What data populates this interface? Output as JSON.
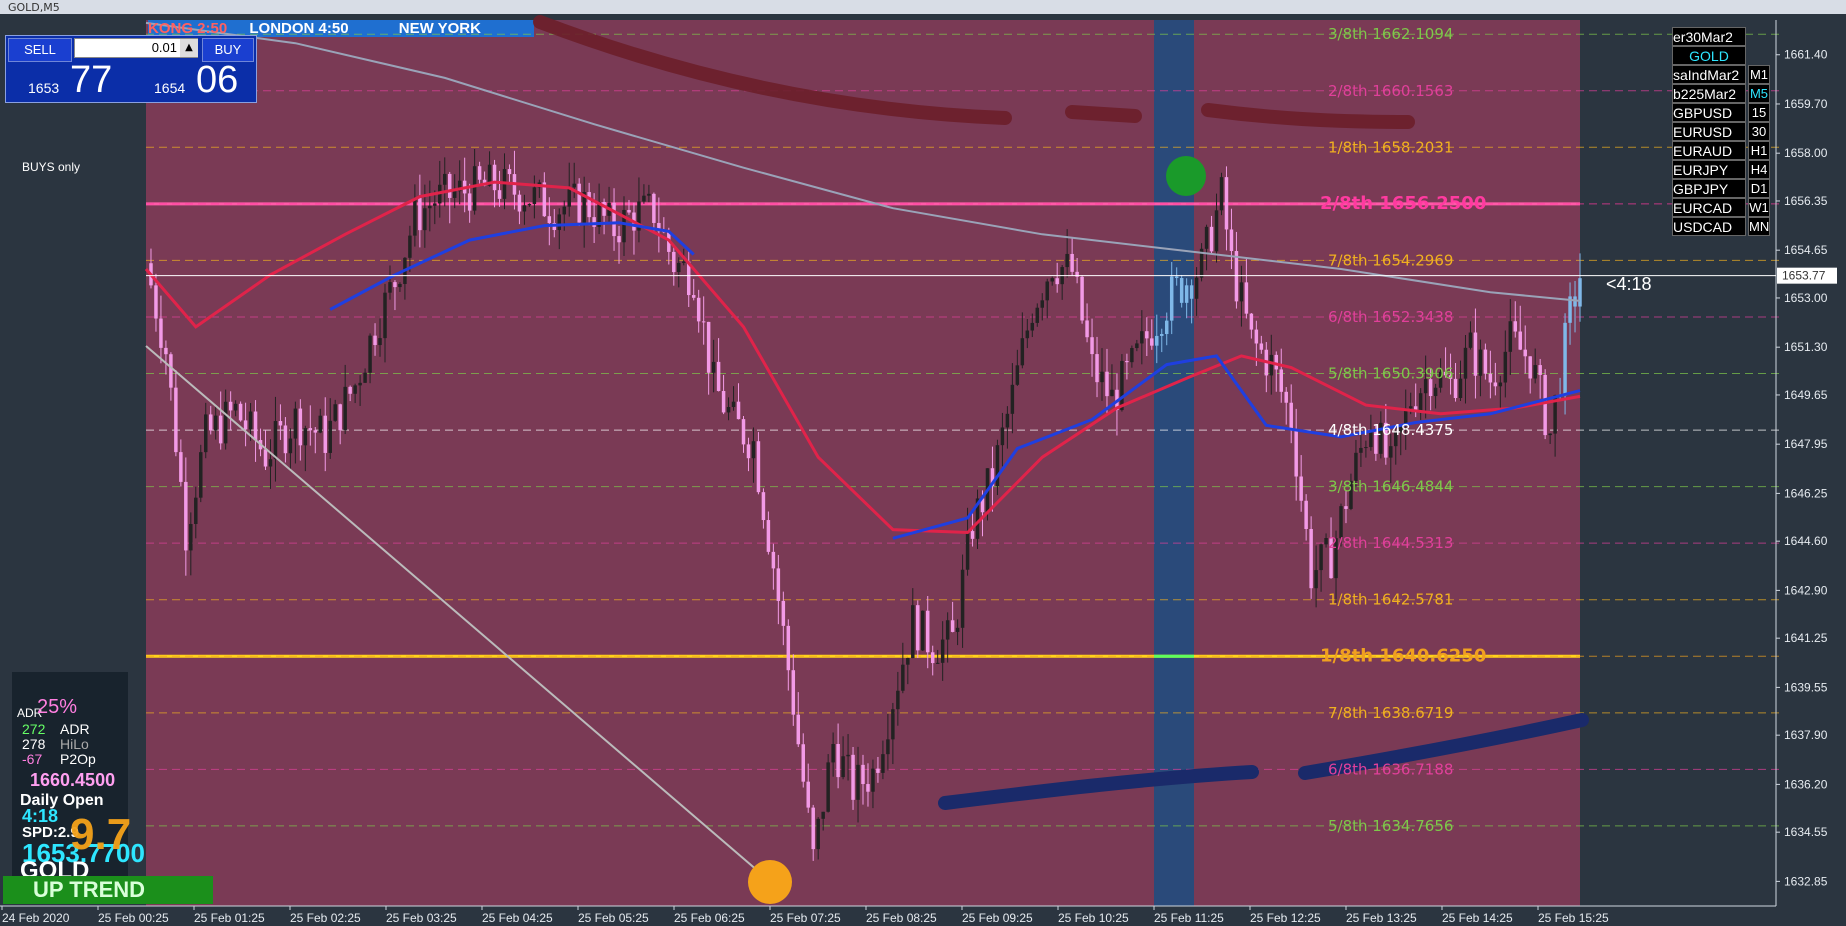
{
  "window": {
    "title": "GOLD,M5"
  },
  "colors": {
    "background": "#2b3540",
    "chart_bg": "#7a3a55",
    "highlight_band": "#2a4a7a",
    "bull_candle": "#222222",
    "bear_candle": "#f29ae6",
    "ma_red": "#e0234a",
    "ma_gray": "#9aa3b8",
    "ma_blue": "#1f3fe0",
    "pink_level": "#ff5aa8",
    "yellow_level": "#ffd21a"
  },
  "sessions": {
    "tokyo": "KONG 2:50",
    "london": "LONDON 4:50",
    "newyork": "NEW YORK"
  },
  "trade_panel": {
    "sell_label": "SELL",
    "buy_label": "BUY",
    "lot": "0.01",
    "sell_prefix": "1653",
    "sell_big": "77",
    "buy_prefix": "1654",
    "buy_big": "06",
    "down_icon": "triangle-down-icon",
    "up_icon": "triangle-up-icon"
  },
  "buys_only": "BUYS only",
  "info_panel": {
    "pct": "25%",
    "adr_val": "272",
    "adr_label": "ADR",
    "adr_tag": "ADR",
    "hilo_val": "278",
    "hilo_label": "HiLo",
    "p2o_val": "-67",
    "p2o_label": "P2Op",
    "daily_open_price": "1660.4500",
    "daily_open_label": "Daily Open",
    "timer": "4:18",
    "spd": "SPD:2.9",
    "price": "1653.7700",
    "big_overlay": "9.7",
    "symbol": "GOLD"
  },
  "trend": "UP TREND",
  "symbols": [
    {
      "name": "er30Mar2",
      "tf": ""
    },
    {
      "name": "GOLD",
      "tf": "",
      "active": true
    },
    {
      "name": "saIndMar2",
      "tf": "M1"
    },
    {
      "name": "b225Mar2",
      "tf": "M5",
      "tf_active": true
    },
    {
      "name": "GBPUSD",
      "tf": "15"
    },
    {
      "name": "EURUSD",
      "tf": "30"
    },
    {
      "name": "EURAUD",
      "tf": "H1"
    },
    {
      "name": "EURJPY",
      "tf": "H4"
    },
    {
      "name": "GBPJPY",
      "tf": "D1"
    },
    {
      "name": "EURCAD",
      "tf": "W1"
    },
    {
      "name": "USDCAD",
      "tf": "MN"
    }
  ],
  "countdown": "<4:18",
  "chart_data": {
    "type": "candlestick",
    "ylim": [
      1632.0,
      1662.6
    ],
    "yticks": [
      "1661.40",
      "1659.70",
      "1658.00",
      "1656.35",
      "1654.65",
      "1653.00",
      "1651.30",
      "1649.65",
      "1647.95",
      "1646.25",
      "1644.60",
      "1642.90",
      "1641.25",
      "1639.55",
      "1637.90",
      "1636.20",
      "1634.55",
      "1632.85"
    ],
    "current_price": "1653.77",
    "xticks": [
      "24 Feb 2020",
      "25 Feb 00:25",
      "25 Feb 01:25",
      "25 Feb 02:25",
      "25 Feb 03:25",
      "25 Feb 04:25",
      "25 Feb 05:25",
      "25 Feb 06:25",
      "25 Feb 07:25",
      "25 Feb 08:25",
      "25 Feb 09:25",
      "25 Feb 10:25",
      "25 Feb 11:25",
      "25 Feb 12:25",
      "25 Feb 13:25",
      "25 Feb 14:25",
      "25 Feb 15:25"
    ],
    "murrey_levels": [
      {
        "label": "3/8th  1662.1094",
        "price": 1662.1094,
        "color": "#7ec84a",
        "style": "small"
      },
      {
        "label": "2/8th  1660.1563",
        "price": 1660.1563,
        "color": "#e0409a",
        "style": "small"
      },
      {
        "label": "1/8th  1658.2031",
        "price": 1658.2031,
        "color": "#f0b020",
        "style": "small"
      },
      {
        "label": "2/8th  1656.2500",
        "price": 1656.25,
        "color": "#ff3aa0",
        "style": "big",
        "line": "#ff5aa8"
      },
      {
        "label": "7/8th  1654.2969",
        "price": 1654.2969,
        "color": "#f0b020",
        "style": "small"
      },
      {
        "label": "6/8th  1652.3438",
        "price": 1652.3438,
        "color": "#e0409a",
        "style": "small"
      },
      {
        "label": "5/8th  1650.3906",
        "price": 1650.3906,
        "color": "#7ec84a",
        "style": "small"
      },
      {
        "label": "4/8th  1648.4375",
        "price": 1648.4375,
        "color": "#ffffff",
        "style": "small"
      },
      {
        "label": "3/8th  1646.4844",
        "price": 1646.4844,
        "color": "#7ec84a",
        "style": "small"
      },
      {
        "label": "2/8th  1644.5313",
        "price": 1644.5313,
        "color": "#e0409a",
        "style": "small"
      },
      {
        "label": "1/8th  1642.5781",
        "price": 1642.5781,
        "color": "#f0b020",
        "style": "small"
      },
      {
        "label": "1/8th  1640.6250",
        "price": 1640.625,
        "color": "#f0a020",
        "style": "big",
        "line": "#ffd21a"
      },
      {
        "label": "7/8th  1638.6719",
        "price": 1638.6719,
        "color": "#f0b020",
        "style": "small"
      },
      {
        "label": "6/8th  1636.7188",
        "price": 1636.7188,
        "color": "#e0409a",
        "style": "small"
      },
      {
        "label": "5/8th  1634.7656",
        "price": 1634.7656,
        "color": "#7ec84a",
        "style": "small"
      }
    ],
    "price_path": [
      [
        0,
        1654.2
      ],
      [
        4,
        1651.2
      ],
      [
        8,
        1645.0
      ],
      [
        12,
        1648.2
      ],
      [
        18,
        1649.1
      ],
      [
        24,
        1647.6
      ],
      [
        30,
        1648.8
      ],
      [
        36,
        1648.2
      ],
      [
        42,
        1650.0
      ],
      [
        46,
        1652.0
      ],
      [
        50,
        1653.6
      ],
      [
        54,
        1655.8
      ],
      [
        58,
        1656.4
      ],
      [
        64,
        1656.7
      ],
      [
        70,
        1656.9
      ],
      [
        76,
        1656.6
      ],
      [
        82,
        1656.1
      ],
      [
        88,
        1656.3
      ],
      [
        94,
        1655.4
      ],
      [
        98,
        1655.9
      ],
      [
        102,
        1656.0
      ],
      [
        106,
        1654.2
      ],
      [
        110,
        1653.8
      ],
      [
        114,
        1650.0
      ],
      [
        118,
        1648.7
      ],
      [
        122,
        1648.0
      ],
      [
        126,
        1643.8
      ],
      [
        130,
        1639.0
      ],
      [
        134,
        1633.6
      ],
      [
        138,
        1637.6
      ],
      [
        142,
        1636.1
      ],
      [
        146,
        1636.6
      ],
      [
        150,
        1639.2
      ],
      [
        154,
        1641.8
      ],
      [
        158,
        1641.0
      ],
      [
        162,
        1641.2
      ],
      [
        166,
        1645.2
      ],
      [
        170,
        1646.8
      ],
      [
        174,
        1649.6
      ],
      [
        178,
        1652.7
      ],
      [
        182,
        1654.2
      ],
      [
        186,
        1653.9
      ],
      [
        190,
        1650.6
      ],
      [
        194,
        1649.5
      ],
      [
        198,
        1650.6
      ],
      [
        202,
        1652.0
      ],
      [
        206,
        1653.1
      ],
      [
        212,
        1654.1
      ],
      [
        216,
        1656.5
      ],
      [
        218,
        1654.2
      ],
      [
        222,
        1651.5
      ],
      [
        226,
        1650.7
      ],
      [
        230,
        1648.8
      ],
      [
        234,
        1643.5
      ],
      [
        238,
        1644.1
      ],
      [
        242,
        1646.7
      ],
      [
        246,
        1648.8
      ],
      [
        250,
        1647.1
      ],
      [
        254,
        1649.5
      ],
      [
        258,
        1650.4
      ],
      [
        262,
        1650.0
      ],
      [
        266,
        1651.2
      ],
      [
        270,
        1650.2
      ],
      [
        274,
        1651.5
      ],
      [
        278,
        1650.9
      ],
      [
        282,
        1648.3
      ],
      [
        286,
        1652.4
      ],
      [
        288,
        1653.8
      ]
    ],
    "ma_red": [
      [
        0,
        1654.0
      ],
      [
        10,
        1652.0
      ],
      [
        25,
        1653.8
      ],
      [
        40,
        1655.2
      ],
      [
        55,
        1656.5
      ],
      [
        70,
        1657.0
      ],
      [
        85,
        1656.8
      ],
      [
        105,
        1655.0
      ],
      [
        120,
        1652.0
      ],
      [
        135,
        1647.5
      ],
      [
        150,
        1645.0
      ],
      [
        165,
        1644.9
      ],
      [
        180,
        1647.5
      ],
      [
        195,
        1649.2
      ],
      [
        210,
        1650.3
      ],
      [
        220,
        1651.0
      ],
      [
        230,
        1650.6
      ],
      [
        245,
        1649.3
      ],
      [
        260,
        1649.0
      ],
      [
        275,
        1649.2
      ],
      [
        288,
        1649.6
      ]
    ],
    "ma_gray": [
      [
        0,
        1662.5
      ],
      [
        30,
        1661.8
      ],
      [
        60,
        1660.6
      ],
      [
        90,
        1659.0
      ],
      [
        120,
        1657.5
      ],
      [
        150,
        1656.1
      ],
      [
        180,
        1655.2
      ],
      [
        210,
        1654.6
      ],
      [
        240,
        1654.0
      ],
      [
        270,
        1653.2
      ],
      [
        288,
        1652.9
      ]
    ],
    "ma_blue": [
      [
        37,
        1652.6
      ],
      [
        50,
        1653.8
      ],
      [
        65,
        1655.0
      ],
      [
        80,
        1655.5
      ],
      [
        95,
        1655.6
      ],
      [
        105,
        1655.3
      ],
      [
        110,
        1654.5
      ]
    ],
    "ma_blue2": [
      [
        150,
        1644.7
      ],
      [
        165,
        1645.4
      ],
      [
        175,
        1647.8
      ],
      [
        190,
        1648.8
      ],
      [
        205,
        1650.7
      ],
      [
        215,
        1651.0
      ],
      [
        225,
        1648.6
      ],
      [
        240,
        1648.2
      ],
      [
        255,
        1648.7
      ],
      [
        270,
        1649.0
      ],
      [
        288,
        1649.8
      ]
    ]
  }
}
